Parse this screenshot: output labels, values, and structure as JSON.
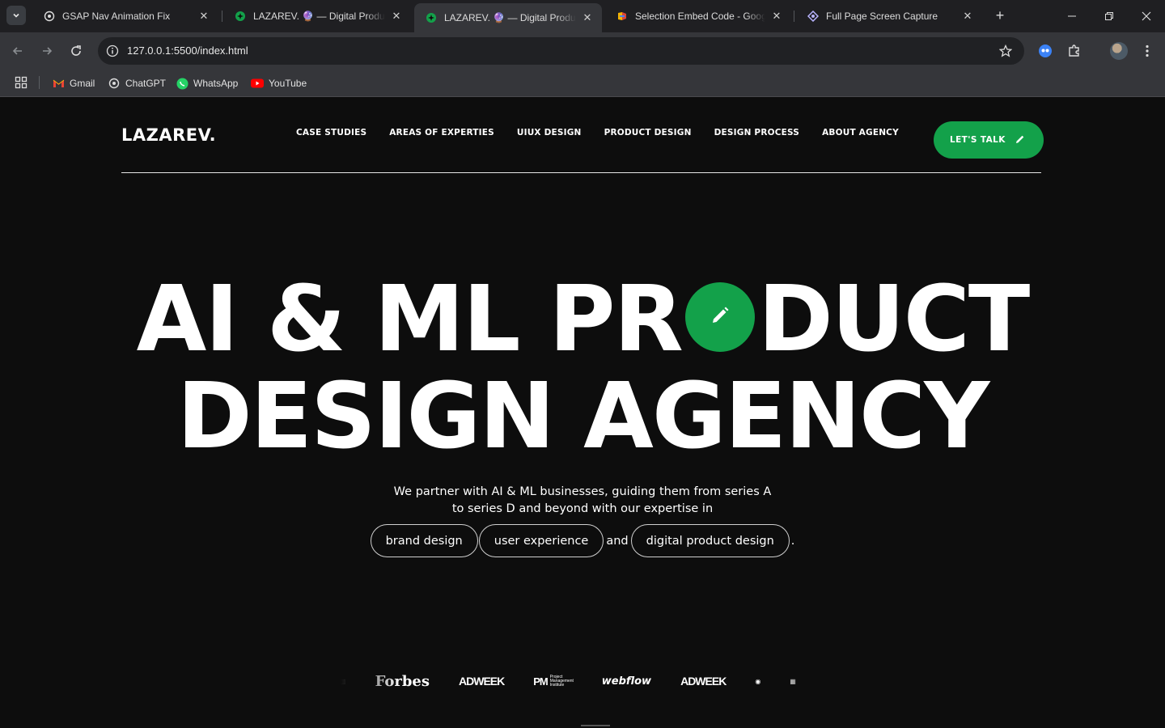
{
  "browser": {
    "tabs": [
      {
        "title": "GSAP Nav Animation Fix",
        "favicon": "openai-icon",
        "active": false
      },
      {
        "title": "LAZAREV. 🔮 — Digital Product",
        "favicon": "green-circle-icon",
        "active": false
      },
      {
        "title": "LAZAREV. 🔮 — Digital Product",
        "favicon": "green-circle-icon",
        "active": true
      },
      {
        "title": "Selection Embed Code - Google",
        "favicon": "google-apps-script-icon",
        "active": false
      },
      {
        "title": "Full Page Screen Capture",
        "favicon": "camera-extension-icon",
        "active": false
      }
    ],
    "url": "127.0.0.1:5500/index.html",
    "bookmarks": [
      {
        "label": "Gmail",
        "icon": "gmail-icon"
      },
      {
        "label": "ChatGPT",
        "icon": "openai-icon"
      },
      {
        "label": "WhatsApp",
        "icon": "whatsapp-icon"
      },
      {
        "label": "YouTube",
        "icon": "youtube-icon"
      }
    ]
  },
  "site": {
    "logo": "LAZAREV.",
    "nav": [
      "CASE STUDIES",
      "AREAS OF EXPERTIES",
      "UIUX DESIGN",
      "PRODUCT DESIGN",
      "DESIGN PROCESS",
      "ABOUT AGENCY"
    ],
    "cta_label": "LET'S TALK",
    "accent_color": "#13a14a",
    "hero": {
      "line1_part1": "AI & ML PR",
      "line1_part2": "DUCT",
      "line2": "DESIGN AGENCY"
    },
    "subtitle_line1": "We partner with AI & ML businesses, guiding them from series A",
    "subtitle_line2": "to series D and beyond with our expertise in",
    "pills": [
      "brand design",
      "user experience",
      "digital product design"
    ],
    "and_text": "and",
    "period": ".",
    "press_logos": [
      "Forbes",
      "ADWEEK",
      "Project Management Institute",
      "webflow",
      "ADWEEK"
    ]
  }
}
